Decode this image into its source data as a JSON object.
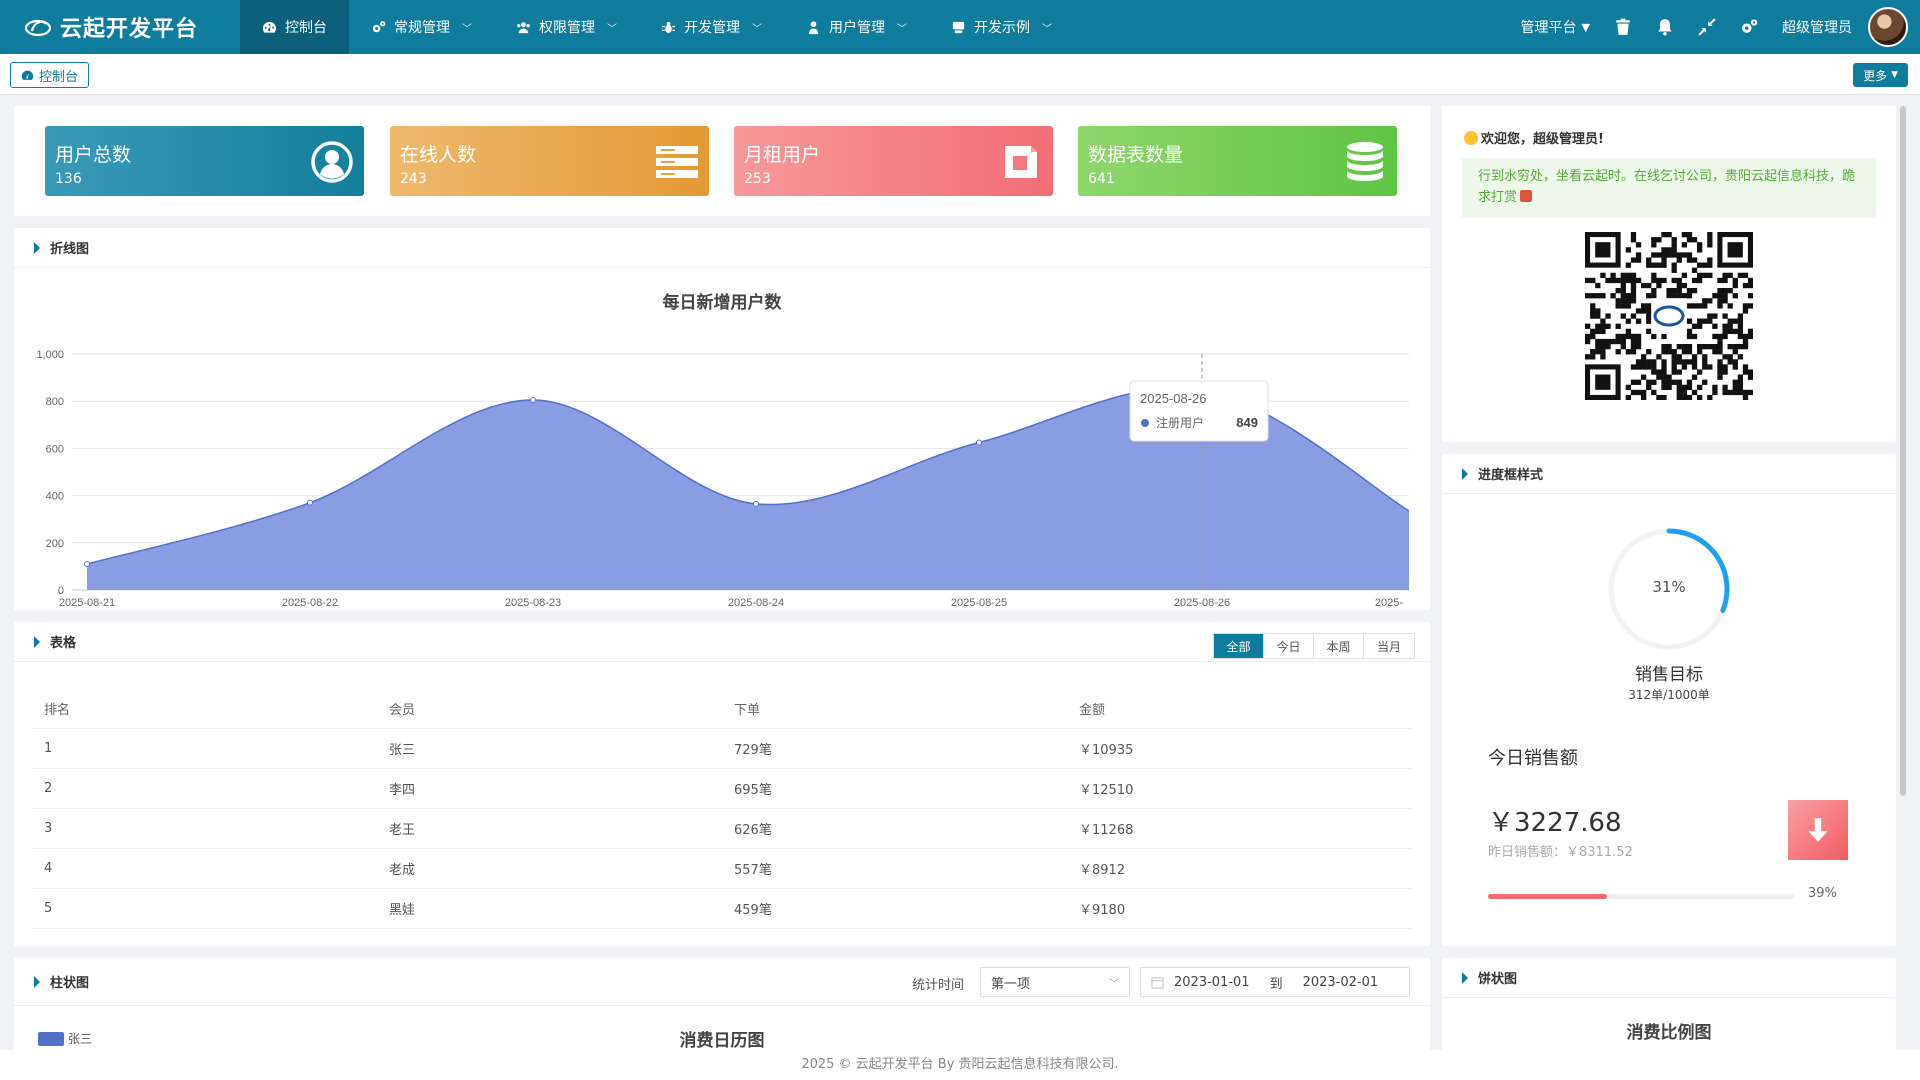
{
  "brand": {
    "title": "云起开发平台"
  },
  "nav": [
    {
      "label": "控制台",
      "icon": "dashboard-icon",
      "active": true
    },
    {
      "label": "常规管理",
      "icon": "cogs-icon"
    },
    {
      "label": "权限管理",
      "icon": "users-icon"
    },
    {
      "label": "开发管理",
      "icon": "bug-icon"
    },
    {
      "label": "用户管理",
      "icon": "user-icon"
    },
    {
      "label": "开发示例",
      "icon": "example-icon"
    }
  ],
  "topright": {
    "platform": "管理平台",
    "username": "超级管理员"
  },
  "tabs": {
    "current": "控制台",
    "more": "更多"
  },
  "stats": [
    {
      "title": "用户总数",
      "value": "136",
      "icon": "user-circle-icon",
      "color": "#1d8aa8"
    },
    {
      "title": "在线人数",
      "value": "243",
      "icon": "server-icon",
      "color": "#e9a445"
    },
    {
      "title": "月租用户",
      "value": "253",
      "icon": "media-icon",
      "color": "#f5777e"
    },
    {
      "title": "数据表数量",
      "value": "641",
      "icon": "database-icon",
      "color": "#72cf5a"
    }
  ],
  "line_panel": {
    "heading": "折线图",
    "chart_data": {
      "type": "area",
      "title": "每日新增用户数",
      "x": [
        "2025-08-21",
        "2025-08-22",
        "2025-08-23",
        "2025-08-24",
        "2025-08-25",
        "2025-08-26",
        "2025-"
      ],
      "series": [
        {
          "name": "注册用户",
          "values": [
            110,
            370,
            805,
            365,
            625,
            849,
            335
          ]
        }
      ],
      "ylim": [
        0,
        1000
      ],
      "yticks": [
        "0",
        "200",
        "400",
        "600",
        "800",
        "1,000"
      ],
      "color": "#8497e0",
      "tooltip": {
        "date": "2025-08-26",
        "series": "注册用户",
        "value": "849"
      }
    }
  },
  "table_panel": {
    "heading": "表格",
    "filters": [
      "全部",
      "今日",
      "本周",
      "当月"
    ],
    "columns": [
      "排名",
      "会员",
      "下单",
      "金额"
    ],
    "rows": [
      [
        "1",
        "张三",
        "729笔",
        "￥10935"
      ],
      [
        "2",
        "李四",
        "695笔",
        "￥12510"
      ],
      [
        "3",
        "老王",
        "626笔",
        "￥11268"
      ],
      [
        "4",
        "老成",
        "557笔",
        "￥8912"
      ],
      [
        "5",
        "黑娃",
        "459笔",
        "￥9180"
      ]
    ]
  },
  "bar_panel": {
    "heading": "柱状图",
    "stat_label": "统计时间",
    "select_value": "第一项",
    "date_from": "2023-01-01",
    "date_sep": "到",
    "date_to": "2023-02-01",
    "chart_title": "消费日历图",
    "legend_first": "张三"
  },
  "welcome": {
    "text": "欢迎您，超级管理员!",
    "notice": "行到水穷处，坐看云起时。在线乞讨公司，贵阳云起信息科技，跪求打赏"
  },
  "progress_panel": {
    "heading": "进度框样式",
    "ring_percent_label": "31%",
    "ring_percent": 31,
    "ring_title": "销售目标",
    "ring_sub": "312单/1000单",
    "today_title": "今日销售额",
    "today_value": "￥3227.68",
    "yesterday": "昨日销售额：￥8311.52",
    "bar_percent_label": "39%",
    "bar_percent": 39
  },
  "pie_panel": {
    "heading": "饼状图",
    "chart_title": "消费比例图"
  },
  "footer": "2025 © 云起开发平台 By 贵阳云起信息科技有限公司."
}
